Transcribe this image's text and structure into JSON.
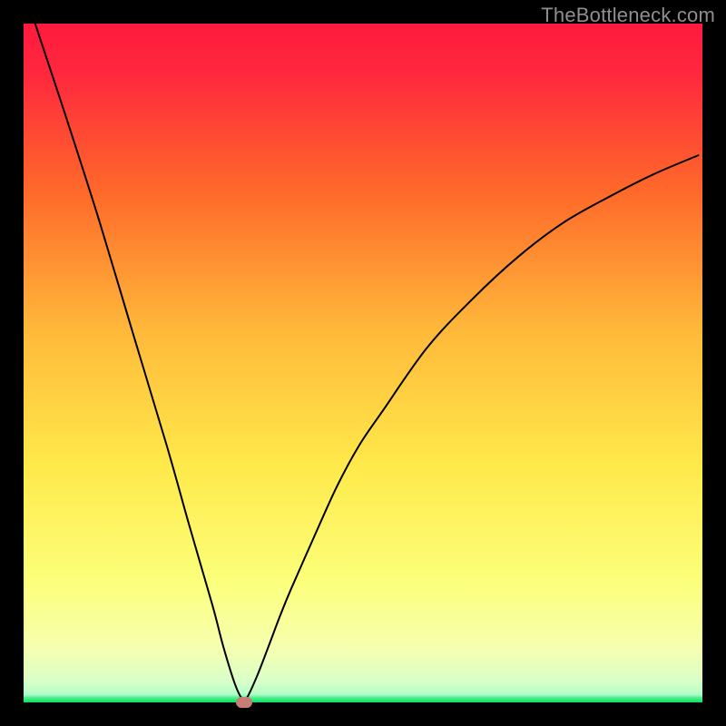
{
  "watermark": "TheBottleneck.com",
  "chart_data": {
    "type": "line",
    "title": "",
    "xlabel": "",
    "ylabel": "",
    "xlim": [
      0,
      1
    ],
    "ylim": [
      0,
      1
    ],
    "background_gradient": [
      "#ff1a3d",
      "#ff7a2a",
      "#ffe94a",
      "#f6ff9c",
      "#00e35b"
    ],
    "series": [
      {
        "name": "bottleneck-curve",
        "x": [
          0.017,
          0.061,
          0.111,
          0.161,
          0.211,
          0.244,
          0.278,
          0.294,
          0.311,
          0.322,
          0.328,
          0.344,
          0.361,
          0.378,
          0.394,
          0.428,
          0.461,
          0.494,
          0.528,
          0.594,
          0.661,
          0.728,
          0.794,
          0.861,
          0.928,
          0.994
        ],
        "y": [
          1.0,
          0.867,
          0.711,
          0.544,
          0.378,
          0.261,
          0.144,
          0.083,
          0.028,
          0.005,
          0.005,
          0.039,
          0.083,
          0.128,
          0.167,
          0.244,
          0.317,
          0.378,
          0.428,
          0.522,
          0.594,
          0.656,
          0.706,
          0.744,
          0.778,
          0.806
        ]
      }
    ],
    "marker": {
      "x": 0.325,
      "y": 0.0,
      "color": "#c97c73"
    },
    "green_band_y_range": [
      0.0,
      0.012
    ]
  },
  "colors": {
    "frame": "#000000",
    "curve": "#000000",
    "watermark": "#8f8f8f"
  }
}
